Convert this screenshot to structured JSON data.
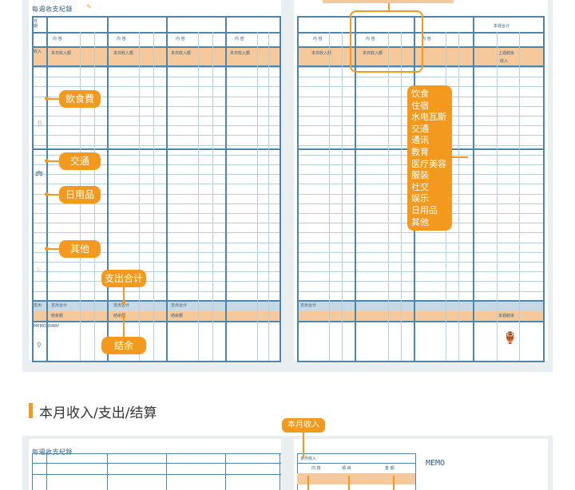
{
  "colors": {
    "accent": "#f39a1e",
    "grid_line": "#b5cfdd",
    "grid_strong": "#4f86a8",
    "band": "#f6c99c",
    "band_blue": "#c7d9e6",
    "spread_bg": "#e9eef1"
  },
  "left_page": {
    "title": "每週收支紀錄",
    "callouts": {
      "food": "飲食費",
      "transport": "交通",
      "daily_goods": "日用品",
      "other": "其他",
      "expense_total": "支出合计",
      "balance": "结余"
    }
  },
  "right_page": {
    "category_list": [
      "饮食",
      "住宿",
      "水电瓦斯",
      "交通",
      "通讯",
      "教育",
      "医疗美容",
      "服装",
      "社交",
      "娱乐",
      "日用品",
      "其他"
    ]
  },
  "section": {
    "title": "本月收入/支出/结算"
  },
  "lower": {
    "callout_income": "本月收入",
    "title": "每週收支紀錄",
    "memo": "MEMO"
  },
  "icons": [
    "pencil-icon",
    "food-icon",
    "utensils-icon",
    "bus-icon",
    "bag-icon",
    "bottle-icon",
    "money-jars-icon"
  ]
}
